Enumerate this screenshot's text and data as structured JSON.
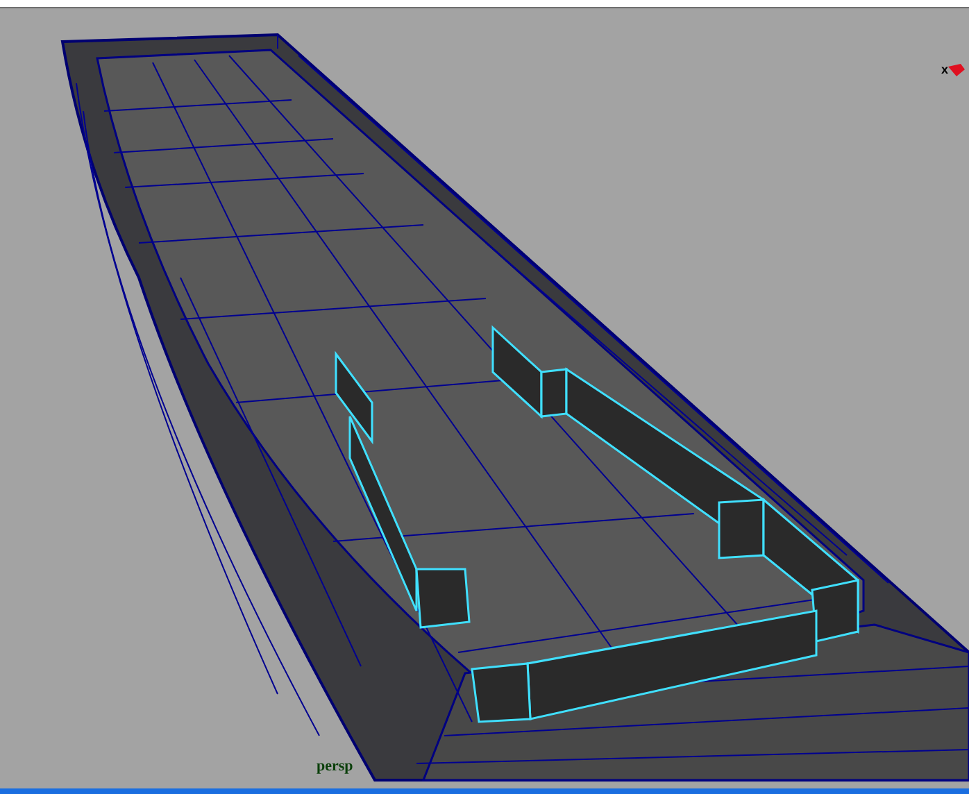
{
  "viewport": {
    "axis_label": "x",
    "camera_label": "persp"
  }
}
